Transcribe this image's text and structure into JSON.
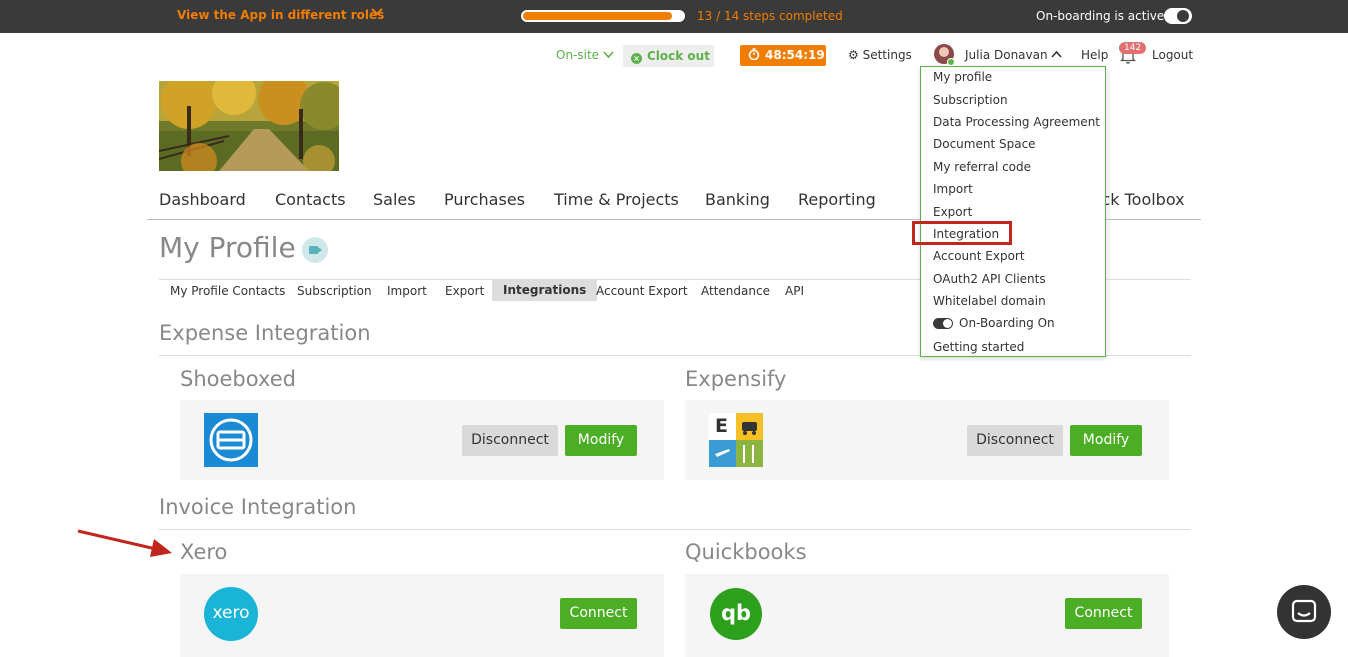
{
  "topbar": {
    "roles_label": "View the App in different roles",
    "progress_percent": 92.9,
    "steps_text": "13 / 14 steps completed",
    "onboarding_label": "On-boarding is active"
  },
  "header": {
    "onsite_label": "On-site",
    "clockout_label": "Clock out",
    "timer": "48:54:19",
    "settings_label": "Settings",
    "user_name": "Julia Donavan",
    "help_label": "Help",
    "notifications_count": "142",
    "logout_label": "Logout"
  },
  "nav": {
    "items": [
      "Dashboard",
      "Contacts",
      "Sales",
      "Purchases",
      "Time & Projects",
      "Banking",
      "Reporting"
    ],
    "quick_toolbox": "ick Toolbox"
  },
  "page": {
    "title": "My Profile"
  },
  "subnav": {
    "items": [
      "My Profile Contacts",
      "Subscription",
      "Import",
      "Export",
      "Integrations",
      "Account Export",
      "Attendance",
      "API"
    ],
    "active_index": 4
  },
  "expense": {
    "title": "Expense Integration",
    "cards": [
      {
        "name": "Shoeboxed",
        "disconnect_label": "Disconnect",
        "modify_label": "Modify"
      },
      {
        "name": "Expensify",
        "disconnect_label": "Disconnect",
        "modify_label": "Modify",
        "logo_letter": "E"
      }
    ]
  },
  "invoice": {
    "title": "Invoice Integration",
    "cards": [
      {
        "name": "Xero",
        "connect_label": "Connect",
        "logo_text": "xero"
      },
      {
        "name": "Quickbooks",
        "connect_label": "Connect",
        "logo_text": "qb"
      }
    ]
  },
  "dropdown": {
    "items": [
      "My profile",
      "Subscription",
      "Data Processing Agreement",
      "Document Space",
      "My referral code",
      "Import",
      "Export",
      "Integration",
      "Account Export",
      "OAuth2 API Clients",
      "Whitelabel domain",
      "On-Boarding On",
      "Getting started"
    ],
    "highlighted_index": 7
  },
  "colors": {
    "accent_orange": "#f07d00",
    "green": "#4cae25",
    "highlight_red": "#c0261c"
  },
  "icons": {
    "roles_chevron": "chevron-down-icon",
    "settings": "gear-icon",
    "bell": "bell-icon",
    "timer": "stopwatch-icon",
    "video": "video-camera-icon",
    "chat": "chat-icon"
  }
}
